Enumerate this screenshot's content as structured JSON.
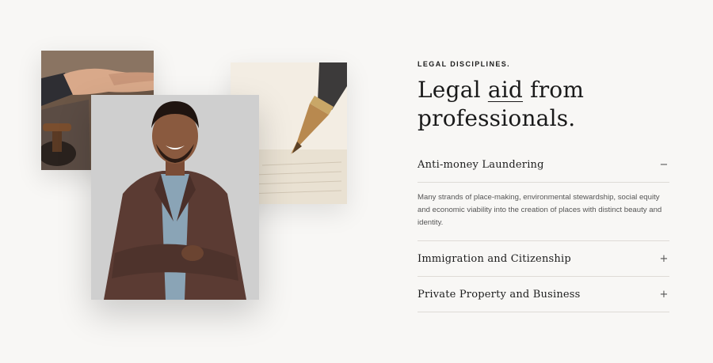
{
  "section": {
    "eyebrow": "LEGAL DISCIPLINES.",
    "headline_pre": "Legal ",
    "headline_underlined": "aid",
    "headline_post": " from professionals."
  },
  "accordion": {
    "items": [
      {
        "title": "Anti-money Laundering",
        "toggle": "−",
        "open": true,
        "body": "Many strands of place-making, environmental stewardship, social equity and economic viability into the creation of places with distinct beauty and identity."
      },
      {
        "title": "Immigration and Citizenship",
        "toggle": "+",
        "open": false
      },
      {
        "title": "Private Property and Business",
        "toggle": "+",
        "open": false
      }
    ]
  },
  "images": {
    "handshake": "handshake-gavel-photo",
    "pen": "fountain-pen-photo",
    "portrait": "smiling-man-portrait-photo"
  },
  "colors": {
    "background": "#f8f7f5",
    "text": "#1c1c1c",
    "divider": "#dedbd6"
  }
}
